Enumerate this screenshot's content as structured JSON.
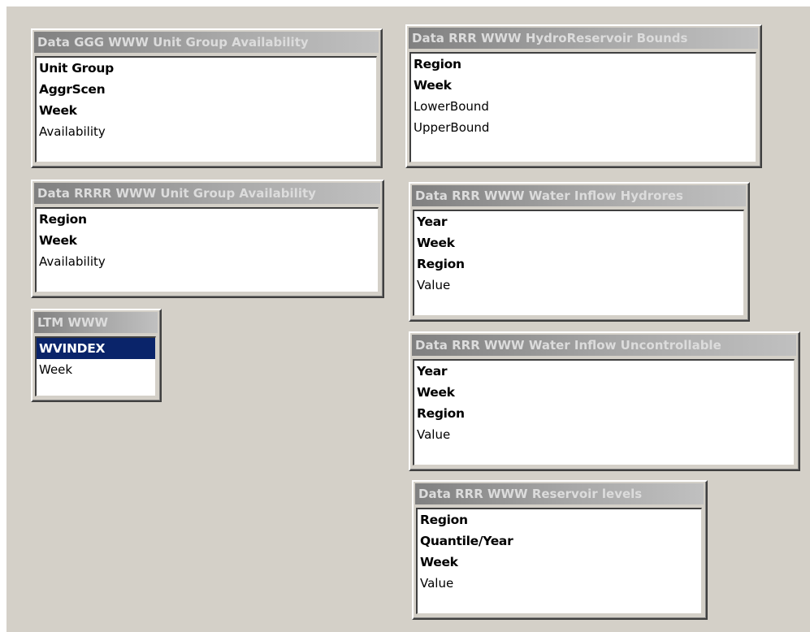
{
  "tables": [
    {
      "title": "Data GGG WWW Unit Group Availability",
      "fields": [
        {
          "label": "Unit Group",
          "key": true
        },
        {
          "label": "AggrScen",
          "key": true
        },
        {
          "label": "Week",
          "key": true
        },
        {
          "label": "Availability",
          "key": false
        }
      ]
    },
    {
      "title": "Data RRRR WWW Unit Group Availability",
      "fields": [
        {
          "label": "Region",
          "key": true
        },
        {
          "label": "Week",
          "key": true
        },
        {
          "label": "Availability",
          "key": false
        }
      ]
    },
    {
      "title": "LTM WWW",
      "fields": [
        {
          "label": "WVINDEX",
          "key": true,
          "selected": true
        },
        {
          "label": "Week",
          "key": false
        }
      ]
    },
    {
      "title": "Data RRR WWW HydroReservoir Bounds",
      "fields": [
        {
          "label": "Region",
          "key": true
        },
        {
          "label": "Week",
          "key": true
        },
        {
          "label": "LowerBound",
          "key": false
        },
        {
          "label": "UpperBound",
          "key": false
        }
      ]
    },
    {
      "title": "Data RRR WWW Water Inflow Hydrores",
      "fields": [
        {
          "label": "Year",
          "key": true
        },
        {
          "label": "Week",
          "key": true
        },
        {
          "label": "Region",
          "key": true
        },
        {
          "label": "Value",
          "key": false
        }
      ]
    },
    {
      "title": "Data RRR WWW Water Inflow Uncontrollable",
      "fields": [
        {
          "label": "Year",
          "key": true
        },
        {
          "label": "Week",
          "key": true
        },
        {
          "label": "Region",
          "key": true
        },
        {
          "label": "Value",
          "key": false
        }
      ]
    },
    {
      "title": "Data RRR WWW Reservoir levels",
      "fields": [
        {
          "label": "Region",
          "key": true
        },
        {
          "label": "Quantile/Year",
          "key": true
        },
        {
          "label": "Week",
          "key": true
        },
        {
          "label": "Value",
          "key": false
        }
      ]
    }
  ],
  "colors": {
    "canvas": "#d4d0c8",
    "title_gradient_start": "#808080",
    "title_text": "#dcdcdc",
    "selection": "#0a246a"
  }
}
